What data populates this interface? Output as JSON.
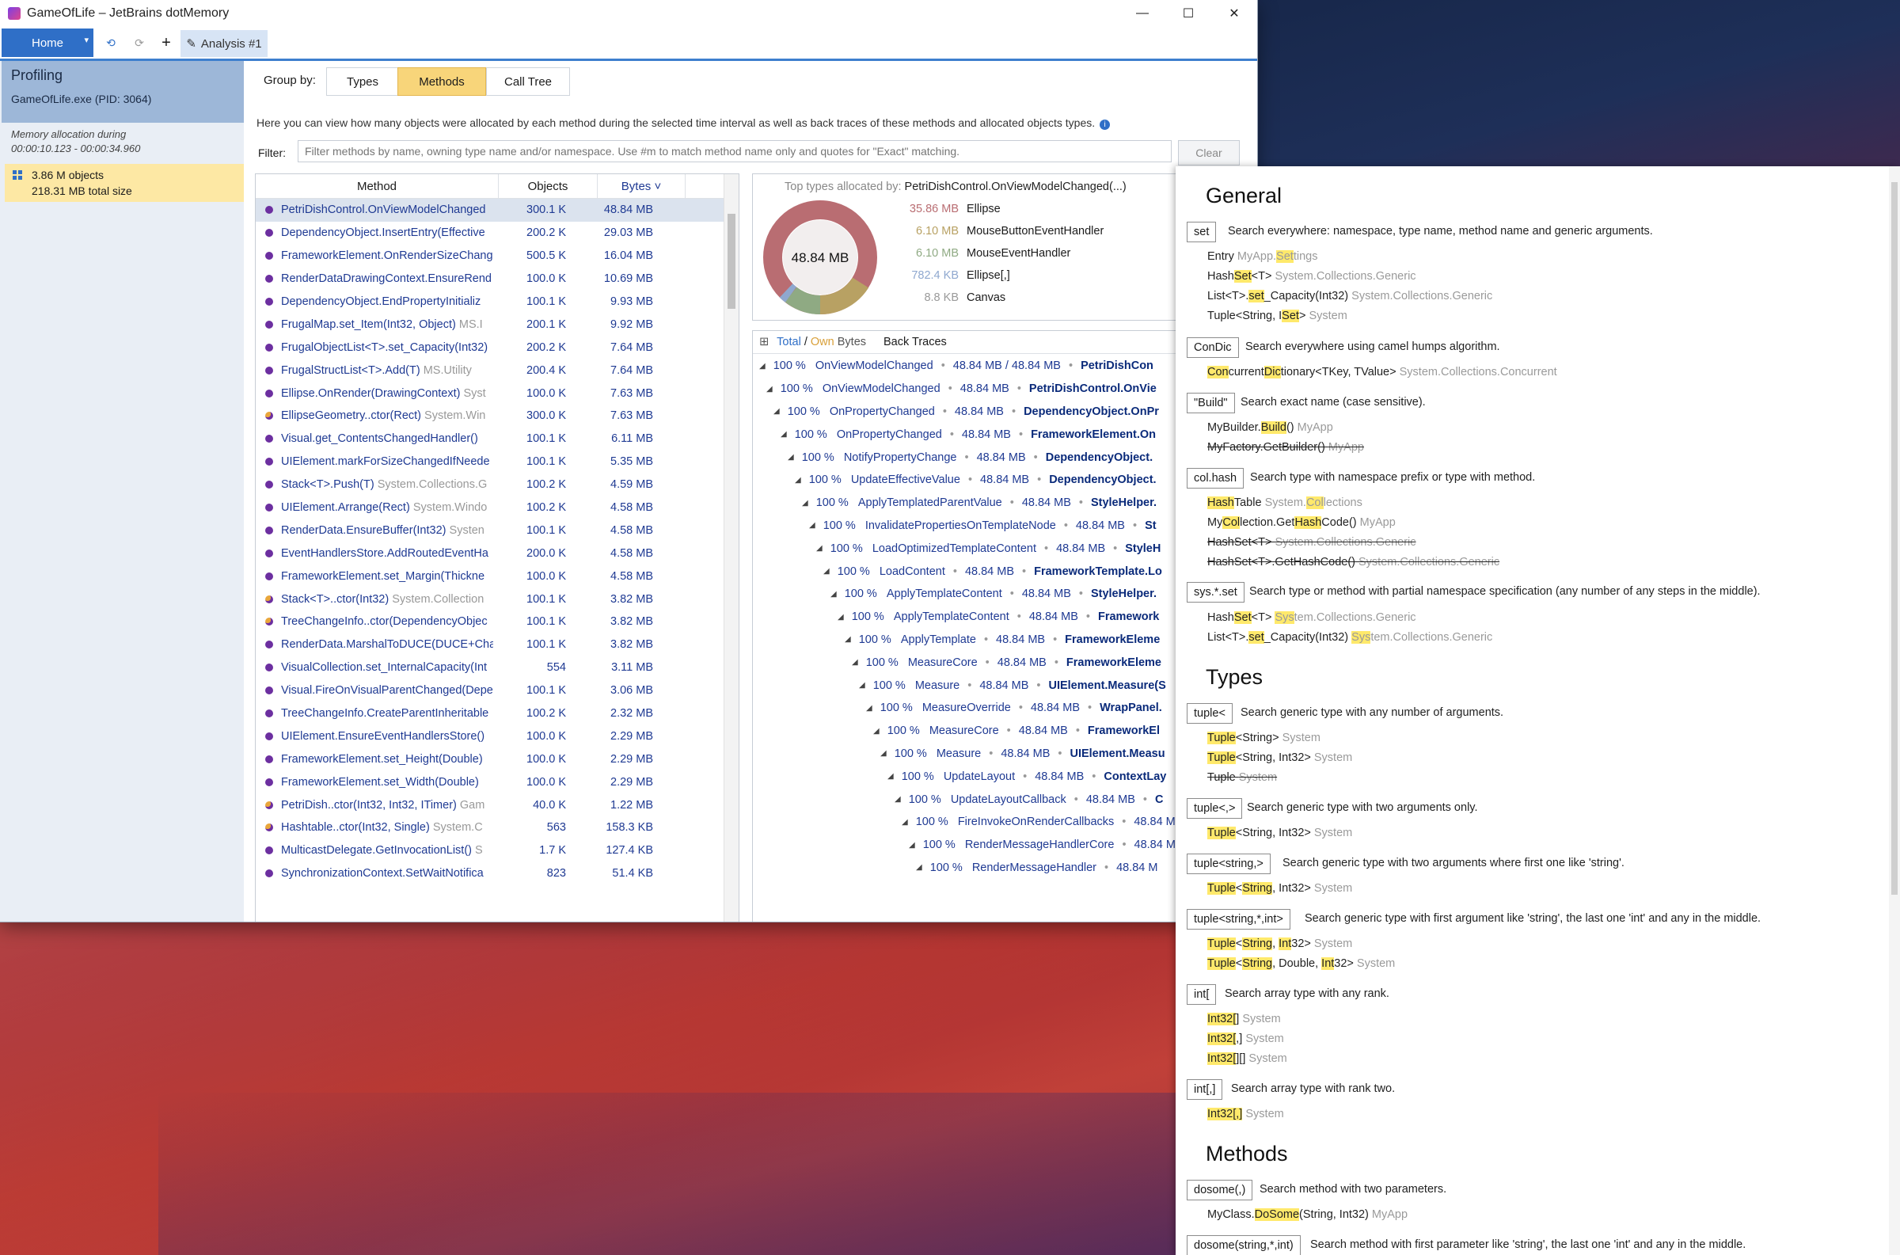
{
  "window": {
    "title": "GameOfLife – JetBrains dotMemory",
    "minimize": "—",
    "maximize": "☐",
    "close": "✕"
  },
  "toolbar": {
    "home": "Home",
    "analysis_tab": "Analysis #1",
    "back_glyph": "⟲",
    "fwd_glyph": "⟳",
    "add_glyph": "+",
    "edit_glyph": "✎",
    "dd_glyph": "▾"
  },
  "sidebar": {
    "title": "Profiling",
    "process": "GameOfLife.exe (PID: 3064)",
    "alloc_label": "Memory allocation during",
    "alloc_range": "00:00:10.123 - 00:00:34.960",
    "objects": "3.86 M objects",
    "size": "218.31 MB total size"
  },
  "groupby": {
    "label": "Group by:",
    "types": "Types",
    "methods": "Methods",
    "calltree": "Call Tree"
  },
  "description": "Here you can view how many objects were allocated by each method during the selected time interval as well as back traces of these methods and allocated objects types.",
  "filter": {
    "label": "Filter:",
    "placeholder": "Filter methods by name, owning type name and/or namespace. Use #m to match method name only and quotes for \"Exact\" matching.",
    "clear": "Clear"
  },
  "methods_table": {
    "columns": {
      "method": "Method",
      "objects": "Objects",
      "bytes": "Bytes ˅"
    },
    "rows": [
      {
        "name": "PetriDishControl.OnViewModelChanged",
        "ns": "",
        "objects": "300.1 K",
        "bytes": "48.84 MB",
        "alt": false
      },
      {
        "name": "DependencyObject.InsertEntry(Effective",
        "ns": "",
        "objects": "200.2 K",
        "bytes": "29.03 MB",
        "alt": false
      },
      {
        "name": "FrameworkElement.OnRenderSizeChang",
        "ns": "",
        "objects": "500.5 K",
        "bytes": "16.04 MB",
        "alt": false
      },
      {
        "name": "RenderDataDrawingContext.EnsureRend",
        "ns": "",
        "objects": "100.0 K",
        "bytes": "10.69 MB",
        "alt": false
      },
      {
        "name": "DependencyObject.EndPropertyInitializ",
        "ns": "",
        "objects": "100.1 K",
        "bytes": "9.93 MB",
        "alt": false
      },
      {
        "name": "FrugalMap.set_Item(Int32, Object)",
        "ns": "MS.I",
        "objects": "200.1 K",
        "bytes": "9.92 MB",
        "alt": false
      },
      {
        "name": "FrugalObjectList<T>.set_Capacity(Int32)",
        "ns": "",
        "objects": "200.2 K",
        "bytes": "7.64 MB",
        "alt": false
      },
      {
        "name": "FrugalStructList<T>.Add(T)",
        "ns": "MS.Utility",
        "objects": "200.4 K",
        "bytes": "7.64 MB",
        "alt": false
      },
      {
        "name": "Ellipse.OnRender(DrawingContext)",
        "ns": "Syst",
        "objects": "100.0 K",
        "bytes": "7.63 MB",
        "alt": false
      },
      {
        "name": "EllipseGeometry..ctor(Rect)",
        "ns": "System.Win",
        "objects": "300.0 K",
        "bytes": "7.63 MB",
        "alt": true
      },
      {
        "name": "Visual.get_ContentsChangedHandler()",
        "ns": "",
        "objects": "100.1 K",
        "bytes": "6.11 MB",
        "alt": false
      },
      {
        "name": "UIElement.markForSizeChangedIfNeede",
        "ns": "",
        "objects": "100.1 K",
        "bytes": "5.35 MB",
        "alt": false
      },
      {
        "name": "Stack<T>.Push(T)",
        "ns": "System.Collections.G",
        "objects": "100.2 K",
        "bytes": "4.59 MB",
        "alt": false
      },
      {
        "name": "UIElement.Arrange(Rect)",
        "ns": "System.Windo",
        "objects": "100.2 K",
        "bytes": "4.58 MB",
        "alt": false
      },
      {
        "name": "RenderData.EnsureBuffer(Int32)",
        "ns": "Systen",
        "objects": "100.1 K",
        "bytes": "4.58 MB",
        "alt": false
      },
      {
        "name": "EventHandlersStore.AddRoutedEventHa",
        "ns": "",
        "objects": "200.0 K",
        "bytes": "4.58 MB",
        "alt": false
      },
      {
        "name": "FrameworkElement.set_Margin(Thickne",
        "ns": "",
        "objects": "100.0 K",
        "bytes": "4.58 MB",
        "alt": false
      },
      {
        "name": "Stack<T>..ctor(Int32)",
        "ns": "System.Collection",
        "objects": "100.1 K",
        "bytes": "3.82 MB",
        "alt": true
      },
      {
        "name": "TreeChangeInfo..ctor(DependencyObjec",
        "ns": "",
        "objects": "100.1 K",
        "bytes": "3.82 MB",
        "alt": true
      },
      {
        "name": "RenderData.MarshalToDUCE(DUCE+Cha",
        "ns": "",
        "objects": "100.1 K",
        "bytes": "3.82 MB",
        "alt": false
      },
      {
        "name": "VisualCollection.set_InternalCapacity(Int",
        "ns": "",
        "objects": "554",
        "bytes": "3.11 MB",
        "alt": false
      },
      {
        "name": "Visual.FireOnVisualParentChanged(Depe",
        "ns": "",
        "objects": "100.1 K",
        "bytes": "3.06 MB",
        "alt": false
      },
      {
        "name": "TreeChangeInfo.CreateParentInheritable",
        "ns": "",
        "objects": "100.2 K",
        "bytes": "2.32 MB",
        "alt": false
      },
      {
        "name": "UIElement.EnsureEventHandlersStore()",
        "ns": "",
        "objects": "100.0 K",
        "bytes": "2.29 MB",
        "alt": false
      },
      {
        "name": "FrameworkElement.set_Height(Double)",
        "ns": "",
        "objects": "100.0 K",
        "bytes": "2.29 MB",
        "alt": false
      },
      {
        "name": "FrameworkElement.set_Width(Double)",
        "ns": "",
        "objects": "100.0 K",
        "bytes": "2.29 MB",
        "alt": false
      },
      {
        "name": "PetriDish..ctor(Int32, Int32, ITimer)",
        "ns": "Gam",
        "objects": "40.0 K",
        "bytes": "1.22 MB",
        "alt": true
      },
      {
        "name": "Hashtable..ctor(Int32, Single)",
        "ns": "System.C",
        "objects": "563",
        "bytes": "158.3 KB",
        "alt": true
      },
      {
        "name": "MulticastDelegate.GetInvocationList()",
        "ns": "S",
        "objects": "1.7 K",
        "bytes": "127.4 KB",
        "alt": false
      },
      {
        "name": "SynchronizationContext.SetWaitNotifica",
        "ns": "",
        "objects": "823",
        "bytes": "51.4 KB",
        "alt": false
      }
    ]
  },
  "top_types": {
    "title_prefix": "Top types allocated by:",
    "method": "PetriDishControl.OnViewModelChanged(...)",
    "total": "48.84 MB",
    "rows": [
      {
        "size": "35.86 MB",
        "name": "Ellipse",
        "color": "#b96d72"
      },
      {
        "size": "6.10 MB",
        "name": "MouseButtonEventHandler",
        "color": "#b8a163"
      },
      {
        "size": "6.10 MB",
        "name": "MouseEventHandler",
        "color": "#8faa83"
      },
      {
        "size": "782.4 KB",
        "name": "Ellipse[,]",
        "color": "#8fa8cf"
      },
      {
        "size": "8.8 KB",
        "name": "Canvas",
        "color": "#9a9a9a"
      }
    ]
  },
  "back_traces": {
    "header_total": "Total",
    "header_sep": "/",
    "header_own": "Own",
    "header_bytes": "Bytes",
    "header_bt": "Back Traces",
    "rows": [
      {
        "pct": "100 %",
        "method": "OnViewModelChanged",
        "mb": "48.84 MB / 48.84 MB",
        "type": "PetriDishCon"
      },
      {
        "pct": "100 %",
        "method": "OnViewModelChanged",
        "mb": "48.84 MB",
        "type": "PetriDishControl.OnVie"
      },
      {
        "pct": "100 %",
        "method": "OnPropertyChanged",
        "mb": "48.84 MB",
        "type": "DependencyObject.OnPr"
      },
      {
        "pct": "100 %",
        "method": "OnPropertyChanged",
        "mb": "48.84 MB",
        "type": "FrameworkElement.On"
      },
      {
        "pct": "100 %",
        "method": "NotifyPropertyChange",
        "mb": "48.84 MB",
        "type": "DependencyObject."
      },
      {
        "pct": "100 %",
        "method": "UpdateEffectiveValue",
        "mb": "48.84 MB",
        "type": "DependencyObject."
      },
      {
        "pct": "100 %",
        "method": "ApplyTemplatedParentValue",
        "mb": "48.84 MB",
        "type": "StyleHelper."
      },
      {
        "pct": "100 %",
        "method": "InvalidatePropertiesOnTemplateNode",
        "mb": "48.84 MB",
        "type": "St"
      },
      {
        "pct": "100 %",
        "method": "LoadOptimizedTemplateContent",
        "mb": "48.84 MB",
        "type": "StyleH"
      },
      {
        "pct": "100 %",
        "method": "LoadContent",
        "mb": "48.84 MB",
        "type": "FrameworkTemplate.Lo"
      },
      {
        "pct": "100 %",
        "method": "ApplyTemplateContent",
        "mb": "48.84 MB",
        "type": "StyleHelper."
      },
      {
        "pct": "100 %",
        "method": "ApplyTemplateContent",
        "mb": "48.84 MB",
        "type": "Framework"
      },
      {
        "pct": "100 %",
        "method": "ApplyTemplate",
        "mb": "48.84 MB",
        "type": "FrameworkEleme"
      },
      {
        "pct": "100 %",
        "method": "MeasureCore",
        "mb": "48.84 MB",
        "type": "FrameworkEleme"
      },
      {
        "pct": "100 %",
        "method": "Measure",
        "mb": "48.84 MB",
        "type": "UIElement.Measure(S"
      },
      {
        "pct": "100 %",
        "method": "MeasureOverride",
        "mb": "48.84 MB",
        "type": "WrapPanel."
      },
      {
        "pct": "100 %",
        "method": "MeasureCore",
        "mb": "48.84 MB",
        "type": "FrameworkEl"
      },
      {
        "pct": "100 %",
        "method": "Measure",
        "mb": "48.84 MB",
        "type": "UIElement.Measu"
      },
      {
        "pct": "100 %",
        "method": "UpdateLayout",
        "mb": "48.84 MB",
        "type": "ContextLay"
      },
      {
        "pct": "100 %",
        "method": "UpdateLayoutCallback",
        "mb": "48.84 MB",
        "type": "C"
      },
      {
        "pct": "100 %",
        "method": "FireInvokeOnRenderCallbacks",
        "mb": "48.84 M",
        "type": ""
      },
      {
        "pct": "100 %",
        "method": "RenderMessageHandlerCore",
        "mb": "48.84 M",
        "type": ""
      },
      {
        "pct": "100 %",
        "method": "RenderMessageHandler",
        "mb": "48.84 M",
        "type": ""
      }
    ]
  },
  "help": {
    "general": "General",
    "types": "Types",
    "methods": "Methods",
    "entries": [
      {
        "kw": "set",
        "desc": "Search everywhere: namespace, type name, method name and generic arguments."
      },
      {
        "kw": "ConDic",
        "desc": "Search everywhere using camel humps algorithm."
      },
      {
        "kw": "\"Build\"",
        "desc": "Search exact name (case sensitive)."
      },
      {
        "kw": "col.hash",
        "desc": "Search type with namespace prefix or type with method."
      },
      {
        "kw": "sys.*.set",
        "desc": "Search type or method with partial namespace specification (any number of any steps in the middle)."
      },
      {
        "kw": "tuple<",
        "desc": "Search generic type with any number of arguments."
      },
      {
        "kw": "tuple<,>",
        "desc": "Search generic type with two arguments only."
      },
      {
        "kw": "tuple<string,>",
        "desc": "Search generic type with two arguments where first one like 'string'."
      },
      {
        "kw": "tuple<string,*,int>",
        "desc": "Search generic type with first argument like 'string', the last one 'int' and any in the middle."
      },
      {
        "kw": "int[",
        "desc": "Search array type with any rank."
      },
      {
        "kw": "int[,]",
        "desc": "Search array type with rank two."
      },
      {
        "kw": "dosome(,)",
        "desc": "Search method with two parameters."
      },
      {
        "kw": "dosome(string,*,int)",
        "desc": "Search method with first parameter like 'string', the last one 'int' and any in the middle."
      }
    ]
  }
}
